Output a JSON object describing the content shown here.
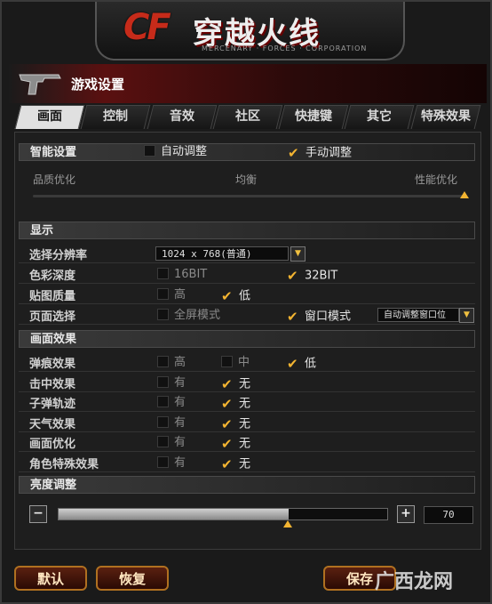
{
  "logo": {
    "cf": "CF",
    "title": "穿越火线",
    "subtitle": "MERCENARY · FORCES · CORPORATION"
  },
  "window_title": "游戏设置",
  "tabs": [
    "画面",
    "控制",
    "音效",
    "社区",
    "快捷键",
    "其它",
    "特殊效果"
  ],
  "sections": {
    "smart": {
      "label": "智能设置",
      "auto_label": "自动调整",
      "manual_label": "手动调整",
      "auto_checked": false,
      "manual_checked": true,
      "quality_label": "品质优化",
      "balance_label": "均衡",
      "performance_label": "性能优化",
      "slider_value": 1.0
    },
    "display": {
      "header": "显示",
      "resolution_label": "选择分辨率",
      "resolution_value": "1024 x 768(普通)",
      "color_depth_label": "色彩深度",
      "color_16": "16BIT",
      "color_32": "32BIT",
      "texture_label": "贴图质量",
      "high": "高",
      "low": "低",
      "screen_label": "页面选择",
      "fullscreen": "全屏模式",
      "windowed": "窗口模式",
      "window_pos_value": "自动调整窗口位"
    },
    "effects": {
      "header": "画面效果",
      "rows": [
        {
          "label": "弹痕效果",
          "options": [
            "高",
            "中",
            "低"
          ],
          "checked": 2
        },
        {
          "label": "击中效果",
          "options": [
            "有",
            "无"
          ],
          "checked": 1
        },
        {
          "label": "子弹轨迹",
          "options": [
            "有",
            "无"
          ],
          "checked": 1
        },
        {
          "label": "天气效果",
          "options": [
            "有",
            "无"
          ],
          "checked": 1
        },
        {
          "label": "画面优化",
          "options": [
            "有",
            "无"
          ],
          "checked": 1
        },
        {
          "label": "角色特殊效果",
          "options": [
            "有",
            "无"
          ],
          "checked": 1
        }
      ]
    },
    "brightness": {
      "header": "亮度调整",
      "value": "70",
      "minus": "−",
      "plus": "+"
    }
  },
  "buttons": {
    "default": "默认",
    "restore": "恢复",
    "save": "保存"
  },
  "watermark": "广西龙网",
  "colors": {
    "accent_check": "#f3b431",
    "title_red": "#5a1010",
    "button_border": "#b07020"
  }
}
